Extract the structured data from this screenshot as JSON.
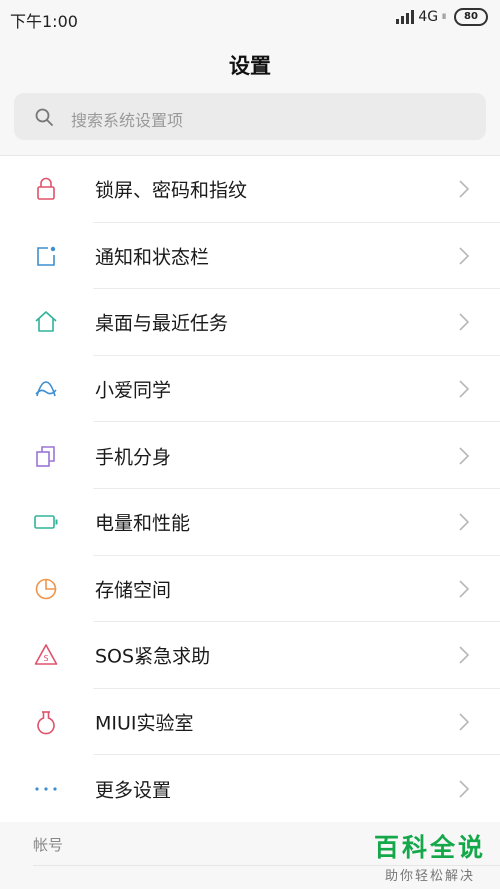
{
  "status": {
    "time": "下午1:00",
    "network": "4G",
    "network_sub": "ll",
    "battery": "80"
  },
  "header": {
    "title": "设置"
  },
  "search": {
    "placeholder": "搜索系统设置项"
  },
  "items": [
    {
      "label": "锁屏、密码和指纹",
      "icon": "lock-icon",
      "color": "#e0526c"
    },
    {
      "label": "通知和状态栏",
      "icon": "notification-icon",
      "color": "#3d8fd1"
    },
    {
      "label": "桌面与最近任务",
      "icon": "home-icon",
      "color": "#2fb39a"
    },
    {
      "label": "小爱同学",
      "icon": "xiaoai-icon",
      "color": "#3d8fd1"
    },
    {
      "label": "手机分身",
      "icon": "dual-space-icon",
      "color": "#9a76d6"
    },
    {
      "label": "电量和性能",
      "icon": "battery-icon",
      "color": "#2fb39a"
    },
    {
      "label": "存储空间",
      "icon": "storage-icon",
      "color": "#f0954a"
    },
    {
      "label": "SOS紧急求助",
      "icon": "sos-icon",
      "color": "#e0526c"
    },
    {
      "label": "MIUI实验室",
      "icon": "lab-flask-icon",
      "color": "#e0526c"
    },
    {
      "label": "更多设置",
      "icon": "more-dots-icon",
      "color": "#3d8fd1"
    }
  ],
  "section": {
    "title": "帐号"
  },
  "watermark": {
    "main": "百科全说",
    "sub": "助你轻松解决"
  }
}
